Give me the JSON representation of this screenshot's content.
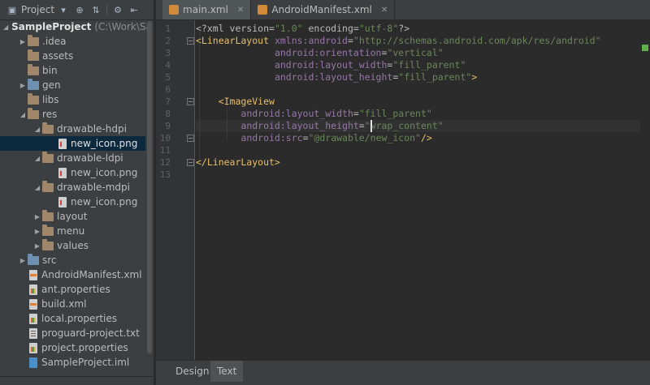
{
  "project_panel": {
    "title": "Project",
    "toolbar_icons": [
      "project-view-icon",
      "target-icon",
      "collapse-icon",
      "gear-icon",
      "hide-icon"
    ],
    "root": {
      "name": "SampleProject",
      "path": "(C:\\Work\\Sa"
    },
    "items": [
      {
        "label": ".idea",
        "type": "folder",
        "level": 1,
        "expanded": false
      },
      {
        "label": "assets",
        "type": "folder",
        "level": 1,
        "leaf": true
      },
      {
        "label": "bin",
        "type": "folder",
        "level": 1,
        "leaf": true
      },
      {
        "label": "gen",
        "type": "folder-blue",
        "level": 1,
        "expanded": false
      },
      {
        "label": "libs",
        "type": "folder",
        "level": 1,
        "leaf": true
      },
      {
        "label": "res",
        "type": "folder",
        "level": 1,
        "expanded": true
      },
      {
        "label": "drawable-hdpi",
        "type": "folder",
        "level": 2,
        "expanded": true
      },
      {
        "label": "new_icon.png",
        "type": "png",
        "level": 3,
        "selected": true
      },
      {
        "label": "drawable-ldpi",
        "type": "folder",
        "level": 2,
        "expanded": true
      },
      {
        "label": "new_icon.png",
        "type": "png",
        "level": 3
      },
      {
        "label": "drawable-mdpi",
        "type": "folder",
        "level": 2,
        "expanded": true
      },
      {
        "label": "new_icon.png",
        "type": "png",
        "level": 3
      },
      {
        "label": "layout",
        "type": "folder",
        "level": 2,
        "expanded": false
      },
      {
        "label": "menu",
        "type": "folder",
        "level": 2,
        "expanded": false
      },
      {
        "label": "values",
        "type": "folder",
        "level": 2,
        "expanded": false
      },
      {
        "label": "src",
        "type": "folder-blue",
        "level": 1,
        "expanded": false
      },
      {
        "label": "AndroidManifest.xml",
        "type": "xml",
        "level": 1
      },
      {
        "label": "ant.properties",
        "type": "props",
        "level": 1
      },
      {
        "label": "build.xml",
        "type": "xml",
        "level": 1
      },
      {
        "label": "local.properties",
        "type": "props",
        "level": 1
      },
      {
        "label": "proguard-project.txt",
        "type": "txt",
        "level": 1
      },
      {
        "label": "project.properties",
        "type": "props",
        "level": 1
      },
      {
        "label": "SampleProject.iml",
        "type": "iml",
        "level": 1
      }
    ]
  },
  "editor_tabs": [
    {
      "label": "main.xml",
      "active": true
    },
    {
      "label": "AndroidManifest.xml",
      "active": false
    }
  ],
  "line_numbers": [
    "1",
    "2",
    "3",
    "4",
    "5",
    "6",
    "7",
    "8",
    "9",
    "10",
    "11",
    "12",
    "13"
  ],
  "code_lines": [
    [
      {
        "t": "plain",
        "s": "<?xml version="
      },
      {
        "t": "str",
        "s": "\"1.0\""
      },
      {
        "t": "plain",
        "s": " encoding="
      },
      {
        "t": "str",
        "s": "\"utf-8\""
      },
      {
        "t": "plain",
        "s": "?>"
      }
    ],
    [
      {
        "t": "tag",
        "s": "<LinearLayout"
      },
      {
        "t": "attr",
        "s": " xmlns:android"
      },
      {
        "t": "plain",
        "s": "="
      },
      {
        "t": "val",
        "s": "\"http://schemas.android.com/apk/res/android\""
      }
    ],
    [
      {
        "t": "plain",
        "s": "              "
      },
      {
        "t": "attr",
        "s": "android:orientation"
      },
      {
        "t": "plain",
        "s": "="
      },
      {
        "t": "val",
        "s": "\"vertical\""
      }
    ],
    [
      {
        "t": "plain",
        "s": "              "
      },
      {
        "t": "attr",
        "s": "android:layout_width"
      },
      {
        "t": "plain",
        "s": "="
      },
      {
        "t": "val",
        "s": "\"fill_parent\""
      }
    ],
    [
      {
        "t": "plain",
        "s": "              "
      },
      {
        "t": "attr",
        "s": "android:layout_height"
      },
      {
        "t": "plain",
        "s": "="
      },
      {
        "t": "val",
        "s": "\"fill_parent\""
      },
      {
        "t": "tag",
        "s": ">"
      }
    ],
    [],
    [
      {
        "t": "plain",
        "s": "    "
      },
      {
        "t": "tag",
        "s": "<ImageView"
      }
    ],
    [
      {
        "t": "plain",
        "s": "        "
      },
      {
        "t": "attr",
        "s": "android:layout_width"
      },
      {
        "t": "plain",
        "s": "="
      },
      {
        "t": "val",
        "s": "\"fill_parent\""
      }
    ],
    [
      {
        "t": "plain",
        "s": "        "
      },
      {
        "t": "attr",
        "s": "android:layout_height"
      },
      {
        "t": "plain",
        "s": "="
      },
      {
        "t": "val",
        "s": "\"wrap_content\""
      }
    ],
    [
      {
        "t": "plain",
        "s": "        "
      },
      {
        "t": "attr",
        "s": "android:src"
      },
      {
        "t": "plain",
        "s": "="
      },
      {
        "t": "val",
        "s": "\"@drawable/new_icon\""
      },
      {
        "t": "tag",
        "s": "/>"
      }
    ],
    [],
    [
      {
        "t": "tag",
        "s": "</LinearLayout>"
      }
    ],
    [],
    []
  ],
  "editor_view_tabs": [
    {
      "label": "Design",
      "active": false
    },
    {
      "label": "Text",
      "active": true
    }
  ],
  "colors": {
    "background": "#2b2b2b",
    "panel": "#3c3f41",
    "tag": "#e8bf6a",
    "attribute": "#9876aa",
    "string": "#6a8759",
    "selected_row": "#0d293e"
  }
}
